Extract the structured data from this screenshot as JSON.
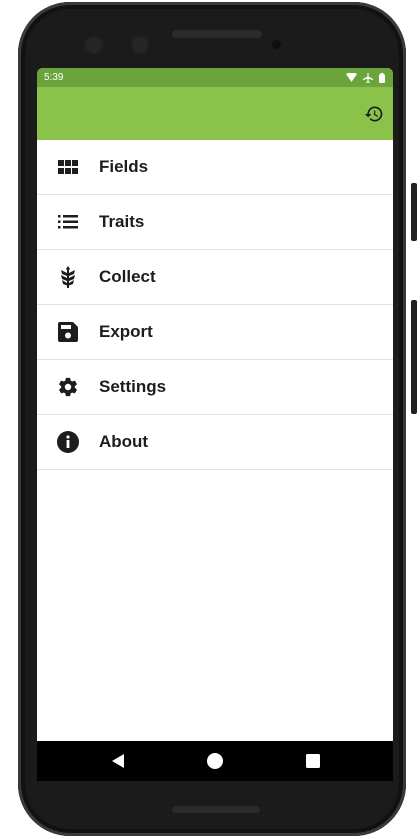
{
  "status_bar": {
    "time": "5:39"
  },
  "toolbar": {
    "history_icon": "history-icon"
  },
  "menu": {
    "items": [
      {
        "label": "Fields",
        "icon": "grid-icon"
      },
      {
        "label": "Traits",
        "icon": "list-icon"
      },
      {
        "label": "Collect",
        "icon": "wheat-icon"
      },
      {
        "label": "Export",
        "icon": "save-icon"
      },
      {
        "label": "Settings",
        "icon": "gear-icon"
      },
      {
        "label": "About",
        "icon": "info-icon"
      }
    ]
  },
  "navigation": {
    "back": "back-triangle-icon",
    "home": "home-circle-icon",
    "recents": "recents-square-icon"
  },
  "colors": {
    "statusbar": "#6aa43a",
    "appbar": "#8bc34a",
    "icon": "#1d1d1d"
  }
}
